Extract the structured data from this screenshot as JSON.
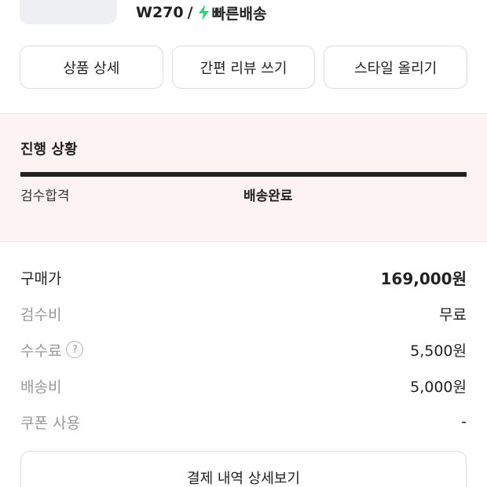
{
  "product": {
    "size": "W270",
    "separator": "/",
    "shipping": "빠른배송",
    "accent_color": "#33d17a"
  },
  "actions": [
    {
      "label": "상품 상세"
    },
    {
      "label": "간편 리뷰 쓰기"
    },
    {
      "label": "스타일 올리기"
    }
  ],
  "progress": {
    "title": "진행 상황",
    "step_done": "검수합격",
    "step_current": "배송완료",
    "completion": 1.0,
    "background_color": "#fdf3f2"
  },
  "prices": [
    {
      "label": "구매가",
      "value": "169,000원"
    },
    {
      "label": "검수비",
      "value": "무료"
    },
    {
      "label": "수수료",
      "value": "5,500원",
      "help": "?"
    },
    {
      "label": "배송비",
      "value": "5,000원"
    },
    {
      "label": "쿠폰 사용",
      "value": "-"
    }
  ],
  "detail_button": {
    "label": "결제 내역 상세보기"
  }
}
